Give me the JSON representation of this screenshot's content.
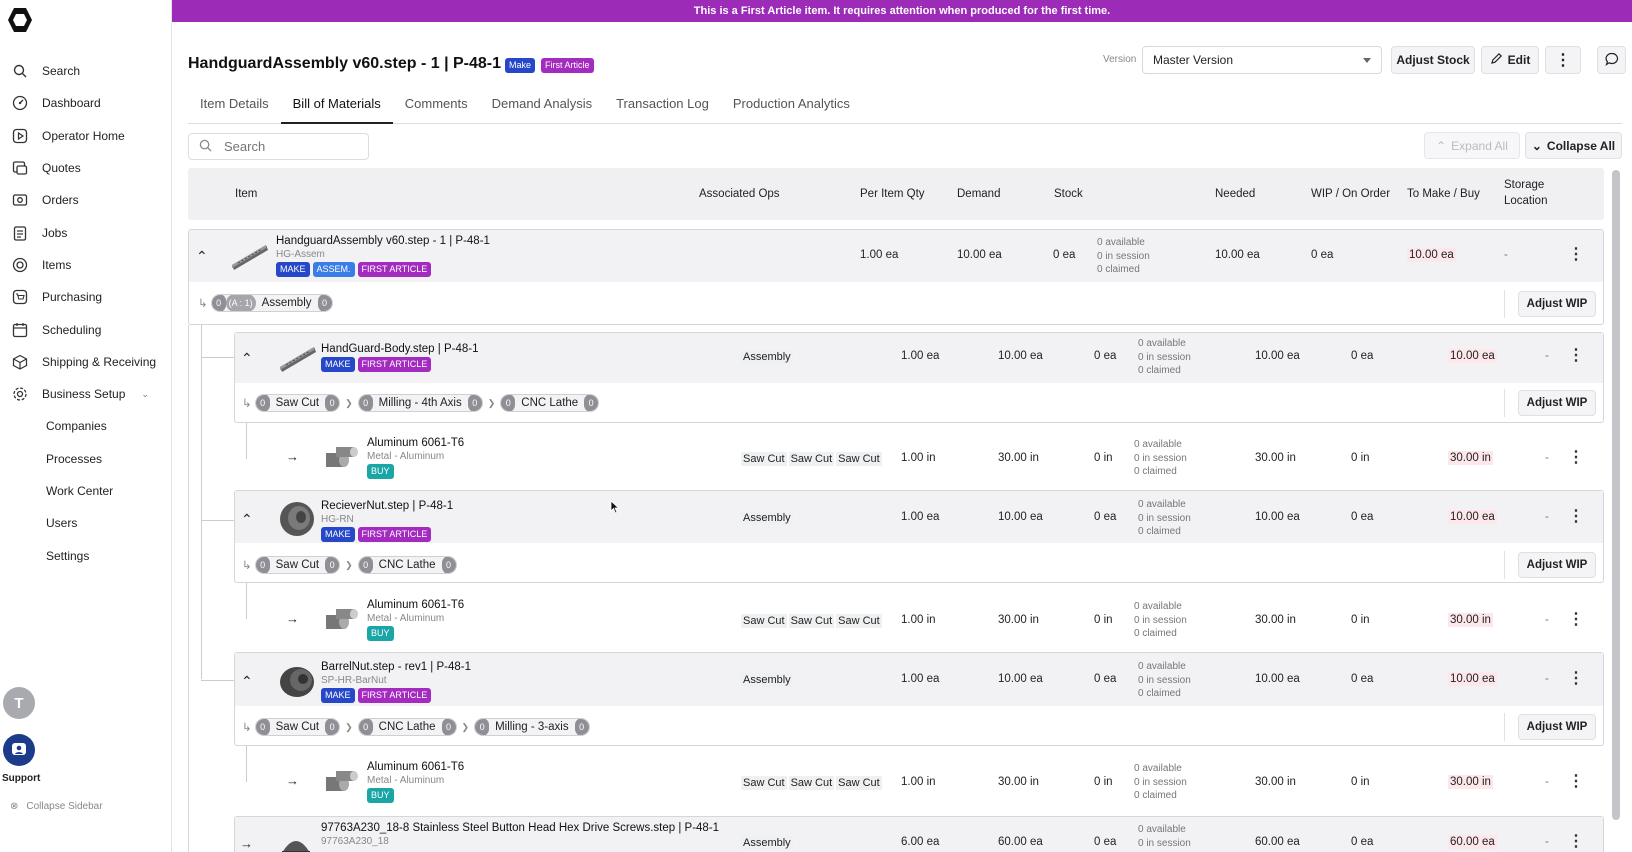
{
  "banner": "This is a First Article item. It requires attention when produced for the first time.",
  "sidebar": {
    "items": [
      {
        "label": "Search",
        "icon": "search-icon"
      },
      {
        "label": "Dashboard",
        "icon": "dashboard-icon"
      },
      {
        "label": "Operator Home",
        "icon": "play-square-icon"
      },
      {
        "label": "Quotes",
        "icon": "quotes-icon"
      },
      {
        "label": "Orders",
        "icon": "orders-icon"
      },
      {
        "label": "Jobs",
        "icon": "clipboard-icon"
      },
      {
        "label": "Items",
        "icon": "target-icon"
      },
      {
        "label": "Purchasing",
        "icon": "cart-icon"
      },
      {
        "label": "Scheduling",
        "icon": "calendar-icon"
      },
      {
        "label": "Shipping & Receiving",
        "icon": "box-icon"
      },
      {
        "label": "Business Setup",
        "icon": "gear-icon"
      }
    ],
    "sub_items": [
      "Companies",
      "Processes",
      "Work Center",
      "Users",
      "Settings"
    ],
    "avatar_letter": "T",
    "support": "Support",
    "collapse": "Collapse Sidebar"
  },
  "header": {
    "title": "HandguardAssembly v60.step - 1 | P-48-1",
    "badges": [
      "Make",
      "First Article"
    ],
    "version_label": "Version",
    "version_value": "Master Version",
    "adjust_stock": "Adjust Stock",
    "edit": "Edit"
  },
  "tabs": [
    "Item Details",
    "Bill of Materials",
    "Comments",
    "Demand Analysis",
    "Transaction Log",
    "Production Analytics"
  ],
  "toolbar": {
    "search_placeholder": "Search",
    "expand_all": "Expand All",
    "collapse_all": "Collapse All"
  },
  "columns": {
    "item": "Item",
    "ops": "Associated Ops",
    "per_item": "Per Item Qty",
    "demand": "Demand",
    "stock": "Stock",
    "needed": "Needed",
    "wip": "WIP / On Order",
    "to_make": "To Make / Buy",
    "storage1": "Storage",
    "storage2": "Location"
  },
  "common": {
    "avail": "0 available",
    "session": "0 in session",
    "claimed": "0 claimed",
    "adjust_wip": "Adjust WIP",
    "dash": "-",
    "zero": "0",
    "saw_cut": "Saw Cut"
  },
  "root": {
    "name": "HandguardAssembly v60.step - 1 | P-48-1",
    "sub": "HG-Assem",
    "badges": [
      "MAKE",
      "ASSEM.",
      "FIRST ARTICLE"
    ],
    "per_item": "1.00 ea",
    "demand": "10.00 ea",
    "stock": "0 ea",
    "needed": "10.00 ea",
    "wip": "0 ea",
    "to_make": "10.00 ea",
    "op_ratio": "(A : 1)",
    "op_label": "Assembly"
  },
  "assemblies": [
    {
      "name": "HandGuard-Body.step | P-48-1",
      "sub": "",
      "badges": [
        "MAKE",
        "FIRST ARTICLE"
      ],
      "ops": "Assembly",
      "per_item": "1.00 ea",
      "demand": "10.00 ea",
      "stock": "0 ea",
      "needed": "10.00 ea",
      "wip": "0 ea",
      "to_make": "10.00 ea",
      "process": [
        "Saw Cut",
        "Milling - 4th Axis",
        "CNC Lathe"
      ],
      "child": {
        "name": "Aluminum 6061-T6",
        "sub": "Metal - Aluminum",
        "badge": "BUY",
        "per_item": "1.00 in",
        "demand": "30.00 in",
        "stock": "0 in",
        "needed": "30.00 in",
        "wip": "0 in",
        "to_make": "30.00 in"
      }
    },
    {
      "name": "RecieverNut.step | P-48-1",
      "sub": "HG-RN",
      "badges": [
        "MAKE",
        "FIRST ARTICLE"
      ],
      "ops": "Assembly",
      "per_item": "1.00 ea",
      "demand": "10.00 ea",
      "stock": "0 ea",
      "needed": "10.00 ea",
      "wip": "0 ea",
      "to_make": "10.00 ea",
      "process": [
        "Saw Cut",
        "CNC Lathe"
      ],
      "child": {
        "name": "Aluminum 6061-T6",
        "sub": "Metal - Aluminum",
        "badge": "BUY",
        "per_item": "1.00 in",
        "demand": "30.00 in",
        "stock": "0 in",
        "needed": "30.00 in",
        "wip": "0 in",
        "to_make": "30.00 in"
      }
    },
    {
      "name": "BarrelNut.step - rev1 | P-48-1",
      "sub": "SP-HR-BarNut",
      "badges": [
        "MAKE",
        "FIRST ARTICLE"
      ],
      "ops": "Assembly",
      "per_item": "1.00 ea",
      "demand": "10.00 ea",
      "stock": "0 ea",
      "needed": "10.00 ea",
      "wip": "0 ea",
      "to_make": "10.00 ea",
      "process": [
        "Saw Cut",
        "CNC Lathe",
        "Milling - 3-axis"
      ],
      "child": {
        "name": "Aluminum 6061-T6",
        "sub": "Metal - Aluminum",
        "badge": "BUY",
        "per_item": "1.00 in",
        "demand": "30.00 in",
        "stock": "0 in",
        "needed": "30.00 in",
        "wip": "0 in",
        "to_make": "30.00 in"
      }
    }
  ],
  "last_row": {
    "name": "97763A230_18-8 Stainless Steel Button Head Hex Drive Screws.step | P-48-1",
    "sub": "97763A230_18",
    "ops": "Assembly",
    "per_item": "6.00 ea",
    "demand": "60.00 ea",
    "stock": "0 ea",
    "session": "0 in session",
    "needed": "60.00 ea",
    "wip": "0 ea",
    "to_make": "60.00 ea"
  }
}
